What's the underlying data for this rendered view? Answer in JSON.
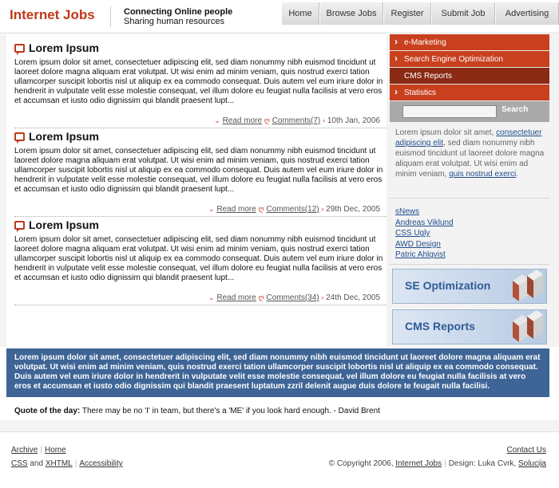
{
  "header": {
    "logo": "Internet Jobs",
    "tagline_line1": "Connecting Online people",
    "tagline_line2": "Sharing human resources",
    "nav": [
      "Home",
      "Browse Jobs",
      "Register",
      "Submit Job",
      "Advertising"
    ]
  },
  "articles": [
    {
      "title": "Lorem Ipsum",
      "body": "Lorem ipsum dolor sit amet, consectetuer adipiscing elit, sed diam nonummy nibh euismod tincidunt ut laoreet dolore magna aliquam erat volutpat. Ut wisi enim ad minim veniam, quis nostrud exerci tation ullamcorper suscipit lobortis nisl ut aliquip ex ea commodo consequat. Duis autem vel eum iriure dolor in hendrerit in vulputate velit esse molestie consequat, vel illum dolore eu feugiat nulla facilisis at vero eros et accumsan et iusto odio dignissim qui blandit praesent lupt...",
      "read_more": "Read more",
      "comments": "Comments(7)",
      "date": "10th Jan, 2006"
    },
    {
      "title": "Lorem Ipsum",
      "body": "Lorem ipsum dolor sit amet, consectetuer adipiscing elit, sed diam nonummy nibh euismod tincidunt ut laoreet dolore magna aliquam erat volutpat. Ut wisi enim ad minim veniam, quis nostrud exerci tation ullamcorper suscipit lobortis nisl ut aliquip ex ea commodo consequat. Duis autem vel eum iriure dolor in hendrerit in vulputate velit esse molestie consequat, vel illum dolore eu feugiat nulla facilisis at vero eros et accumsan et iusto odio dignissim qui blandit praesent lupt...",
      "read_more": "Read more",
      "comments": "Comments(12)",
      "date": "29th Dec, 2005"
    },
    {
      "title": "Lorem Ipsum",
      "body": "Lorem ipsum dolor sit amet, consectetuer adipiscing elit, sed diam nonummy nibh euismod tincidunt ut laoreet dolore magna aliquam erat volutpat. Ut wisi enim ad minim veniam, quis nostrud exerci tation ullamcorper suscipit lobortis nisl ut aliquip ex ea commodo consequat. Duis autem vel eum iriure dolor in hendrerit in vulputate velit esse molestie consequat, vel illum dolore eu feugiat nulla facilisis at vero eros et accumsan et iusto odio dignissim qui blandit praesent lupt...",
      "read_more": "Read more",
      "comments": "Comments(34)",
      "date": "24th Dec, 2005"
    }
  ],
  "sidebar": {
    "menu": [
      "e-Marketing",
      "Search Engine Optimization",
      "CMS Reports",
      "Statistics"
    ],
    "search_button": "Search",
    "search_value": "",
    "text_1": "Lorem ipsum dolor sit amet,",
    "text_link_1": "consectetuer adipiscing elit",
    "text_2": ", sed diam nonummy nibh euismod tincidunt ut laoreet dolore magna aliquam erat volutpat. Ut wisi enim ad minim veniam,",
    "text_link_2": "quis nostrud exerci",
    "text_3": ".",
    "links": [
      "sNews",
      "Andreas Viklund",
      "CSS Ugly",
      "AWD Design",
      "Patric Ahlqvist"
    ],
    "banners": [
      "SE Optimization",
      "CMS Reports"
    ]
  },
  "band_text": "Lorem ipsum dolor sit amet, consectetuer adipiscing elit, sed diam nonummy nibh euismod tincidunt ut laoreet dolore magna aliquam erat volutpat. Ut wisi enim ad minim veniam, quis nostrud exerci tation ullamcorper suscipit lobortis nisl ut aliquip ex ea commodo consequat. Duis autem vel eum iriure dolor in hendrerit in vulputate velit esse molestie consequat, vel illum dolore eu feugiat nulla facilisis at vero eros et accumsan et iusto odio dignissim qui blandit praesent luptatum zzril delenit augue duis dolore te feugait nulla facilisi.",
  "quote": {
    "label": "Quote of the day:",
    "text": "There may be no 'I' in team, but there's a 'ME' if you look hard enough. - David Brent"
  },
  "footer": {
    "archive": "Archive",
    "home": "Home",
    "css": "CSS",
    "and": "and",
    "xhtml": "XHTML",
    "accessibility": "Accessibility",
    "contact": "Contact Us",
    "copyright": "© Copyright 2006,",
    "site_link": "Internet Jobs",
    "design_label": "Design: Luka Cvrk,",
    "design_link": "Solucija"
  },
  "colors": {
    "accent": "#c8401d",
    "accent_dark": "#8a2a14",
    "band": "#3e6596",
    "link": "#1f4c8c"
  }
}
